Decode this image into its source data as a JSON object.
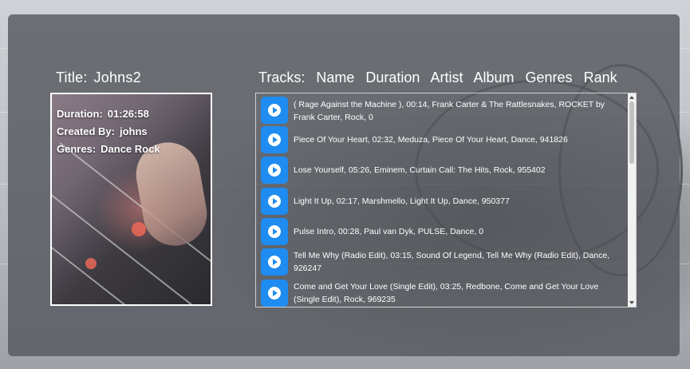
{
  "playlist": {
    "title_label": "Title:",
    "title_value": "Johns2",
    "duration_label": "Duration:",
    "duration_value": "01:26:58",
    "created_label": "Created By:",
    "created_value": "johns",
    "genres_label": "Genres:",
    "genres_value": "Dance Rock"
  },
  "tracks": {
    "label": "Tracks:",
    "columns": [
      "Name",
      "Duration",
      "Artist",
      "Album",
      "Genres",
      "Rank"
    ],
    "rows": [
      {
        "text": "( Rage Against the Machine ),  00:14,  Frank Carter & The Rattlesnakes,  ROCKET by Frank Carter,  Rock,  0"
      },
      {
        "text": "Piece Of Your Heart,  02:32,  Meduza,  Piece Of Your Heart,  Dance,  941826"
      },
      {
        "text": "Lose Yourself,  05:26,  Eminem,  Curtain Call: The Hits,  Rock,  955402"
      },
      {
        "text": "Light It Up,  02:17,  Marshmello,  Light It Up,  Dance,  950377"
      },
      {
        "text": "Pulse Intro,  00:28,  Paul van Dyk,  PULSE,  Dance,  0"
      },
      {
        "text": "Tell Me Why (Radio Edit),  03:15,  Sound Of Legend,  Tell Me Why (Radio Edit),  Dance,  926247"
      },
      {
        "text": "Come and Get Your Love (Single Edit),  03:25,  Redbone,  Come and Get Your Love (Single Edit),  Rock,  969235"
      }
    ]
  },
  "icons": {
    "play": "play-circle-icon"
  },
  "colors": {
    "play_button": "#1e8cf0",
    "panel": "#55585e"
  }
}
